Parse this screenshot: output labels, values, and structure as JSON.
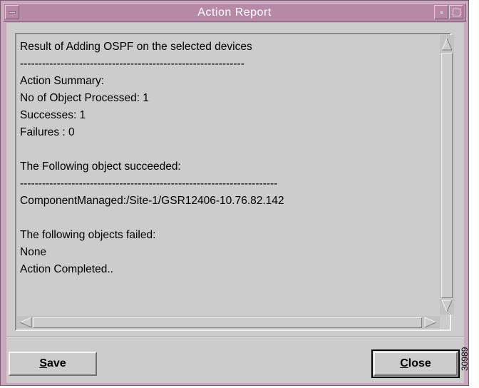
{
  "window": {
    "title": "Action Report"
  },
  "report": {
    "lines": [
      "Result of Adding OSPF on the selected devices",
      "-------------------------------------------------------------",
      "Action Summary:",
      "No of Object Processed: 1",
      "Successes: 1",
      "Failures : 0",
      "",
      "The Following object succeeded:",
      "----------------------------------------------------------------------",
      "ComponentManaged:/Site-1/GSR12406-10.76.82.142",
      "",
      "The following objects failed:",
      "None",
      "Action Completed.."
    ]
  },
  "buttons": {
    "save": {
      "mnemonic": "S",
      "rest": "ave"
    },
    "close": {
      "mnemonic": "C",
      "rest": "lose"
    }
  },
  "figure_id": "30989",
  "icons": {
    "menu": "window-menu-icon",
    "minimize": "minimize-icon",
    "maximize": "maximize-icon",
    "up": "scroll-up-arrow-icon",
    "down": "scroll-down-arrow-icon",
    "left": "scroll-left-arrow-icon",
    "right": "scroll-right-arrow-icon"
  },
  "colors": {
    "frame": "#c9a8bd",
    "titlebar": "#b68aa6",
    "client": "#cccccc"
  }
}
